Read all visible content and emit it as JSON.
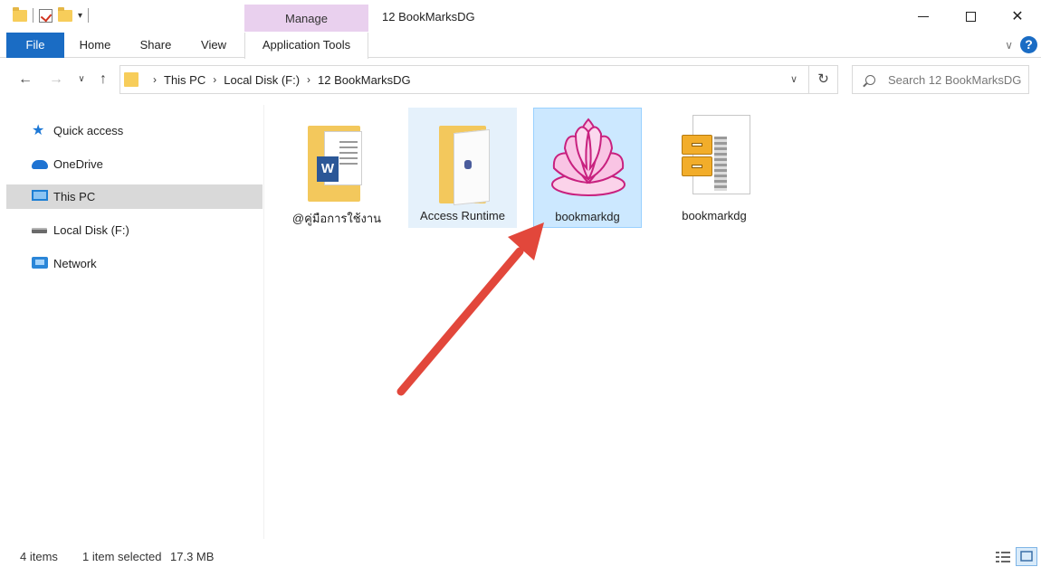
{
  "window": {
    "title": "12 BookMarksDG",
    "context_tab": "Manage"
  },
  "ribbon": {
    "tabs": [
      "File",
      "Home",
      "Share",
      "View",
      "Application Tools"
    ],
    "accent": "#1a6cc4",
    "context_color": "#e9d0ee"
  },
  "address": {
    "crumbs": [
      "This PC",
      "Local Disk (F:)",
      "12 BookMarksDG"
    ]
  },
  "search": {
    "placeholder": "Search 12 BookMarksDG"
  },
  "sidebar": {
    "items": [
      {
        "label": "Quick access",
        "icon": "star-icon"
      },
      {
        "label": "OneDrive",
        "icon": "cloud-icon"
      },
      {
        "label": "This PC",
        "icon": "computer-icon",
        "selected": true
      },
      {
        "label": "Local Disk (F:)",
        "icon": "drive-icon"
      },
      {
        "label": "Network",
        "icon": "network-icon"
      }
    ]
  },
  "files": [
    {
      "name": "@คู่มือการใช้งาน",
      "type": "folder-with-word-doc"
    },
    {
      "name": "Access Runtime",
      "type": "folder"
    },
    {
      "name": "bookmarkdg",
      "type": "application",
      "selected": true
    },
    {
      "name": "bookmarkdg",
      "type": "zip-archive"
    }
  ],
  "status": {
    "count": "4 items",
    "selection": "1 item selected",
    "size": "17.3 MB"
  },
  "annotation": {
    "arrow_color": "#e2473b"
  }
}
